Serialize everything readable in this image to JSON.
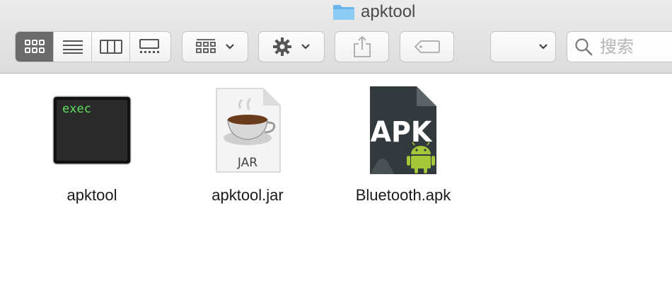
{
  "window": {
    "title": "apktool"
  },
  "toolbar": {
    "view_modes": [
      "icon-view",
      "list-view",
      "column-view",
      "gallery-view"
    ],
    "selected_view": "icon-view",
    "search_placeholder": "搜索"
  },
  "files": [
    {
      "name": "apktool",
      "kind": "unix-executable",
      "icon_text": "exec"
    },
    {
      "name": "apktool.jar",
      "kind": "jar",
      "icon_text": "JAR"
    },
    {
      "name": "Bluetooth.apk",
      "kind": "apk",
      "icon_text": "APK"
    }
  ],
  "colors": {
    "folder": "#6ab6ec",
    "selected_segment": "#6b6b6b",
    "android_green": "#a4c639",
    "exec_green": "#5ee05e"
  }
}
